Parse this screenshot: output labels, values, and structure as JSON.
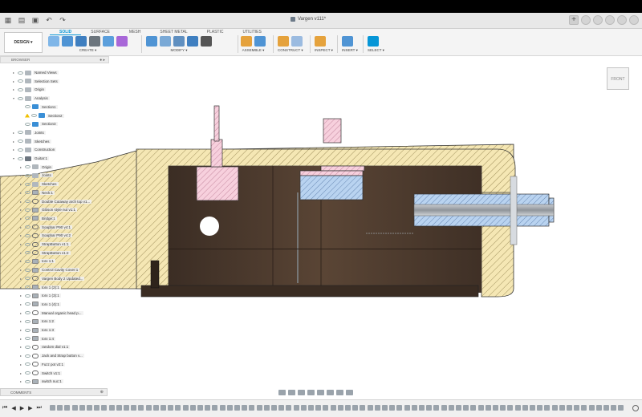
{
  "app": {
    "document_title": "Vargen v111*",
    "design_button": "DESIGN ▾"
  },
  "tabs": [
    "SOLID",
    "SURFACE",
    "MESH",
    "SHEET METAL",
    "PLASTIC",
    "UTILITIES"
  ],
  "active_tab": "SOLID",
  "toolbar_groups": [
    {
      "label": "CREATE ▾"
    },
    {
      "label": "MODIFY ▾"
    },
    {
      "label": "ASSEMBLE ▾"
    },
    {
      "label": "CONSTRUCT ▾"
    },
    {
      "label": "INSPECT ▾"
    },
    {
      "label": "INSERT ▾"
    },
    {
      "label": "SELECT ▾"
    }
  ],
  "browser": {
    "title": "BROWSER",
    "items": [
      {
        "label": "Named Views",
        "icon": "folder-icon"
      },
      {
        "label": "Selection Sets",
        "icon": "folder-icon"
      },
      {
        "label": "Origin",
        "icon": "folder-icon"
      },
      {
        "label": "Analysis",
        "icon": "folder-icon"
      },
      {
        "label": "Section1",
        "icon": "section-icon"
      },
      {
        "label": "Section2",
        "icon": "section-icon"
      },
      {
        "label": "Section3",
        "icon": "section-icon"
      },
      {
        "label": "Joints",
        "icon": "folder-icon"
      },
      {
        "label": "Sketches",
        "icon": "folder-icon"
      },
      {
        "label": "Construction",
        "icon": "folder-icon"
      },
      {
        "label": "Guitar:1",
        "icon": "component-icon"
      },
      {
        "label": "Origin",
        "icon": "folder-icon"
      },
      {
        "label": "Joints",
        "icon": "folder-icon"
      },
      {
        "label": "Sketches",
        "icon": "folder-icon"
      },
      {
        "label": "Neck:1",
        "icon": "body-icon"
      },
      {
        "label": "Double Cutaway arch top v1...",
        "icon": "link-icon"
      },
      {
        "label": "Gibson style nut v1:1",
        "icon": "body-icon"
      },
      {
        "label": "Bridge:1",
        "icon": "body-icon"
      },
      {
        "label": "Soapbar P90 v4:1",
        "icon": "link-icon"
      },
      {
        "label": "Soapbar P90 v4:2",
        "icon": "link-icon"
      },
      {
        "label": "StrapButton v1:1",
        "icon": "link-icon"
      },
      {
        "label": "StrapButton v1:2",
        "icon": "link-icon"
      },
      {
        "label": "torx 1:1",
        "icon": "body-icon"
      },
      {
        "label": "Control Cavity Cover:1",
        "icon": "body-icon"
      },
      {
        "label": "Vargen Body 2 Updated...",
        "icon": "link-icon"
      },
      {
        "label": "torx 1 (2):1",
        "icon": "body-icon"
      },
      {
        "label": "torx 1 (3):1",
        "icon": "body-icon"
      },
      {
        "label": "torx 1 (4):1",
        "icon": "body-icon"
      },
      {
        "label": "Manual organic head p...",
        "icon": "link-icon"
      },
      {
        "label": "torx 1:2",
        "icon": "body-icon"
      },
      {
        "label": "torx 1:3",
        "icon": "body-icon"
      },
      {
        "label": "torx 1:4",
        "icon": "body-icon"
      },
      {
        "label": "random dial v1:1",
        "icon": "link-icon"
      },
      {
        "label": "Jack and Strap button v...",
        "icon": "link-icon"
      },
      {
        "label": "Fuzz pot v2:1",
        "icon": "link-icon"
      },
      {
        "label": "Switch v1:1",
        "icon": "link-icon"
      },
      {
        "label": "switch nuc:1",
        "icon": "body-icon"
      }
    ]
  },
  "viewcube": {
    "face": "FRONT"
  },
  "comments": {
    "title": "COMMENTS"
  },
  "colors": {
    "accent": "#0696d7",
    "wood": "#4a3a30",
    "hatch_yellow": "#f3e2a6",
    "section_pink": "#f2c4d2",
    "section_blue": "#a9c7ea"
  }
}
